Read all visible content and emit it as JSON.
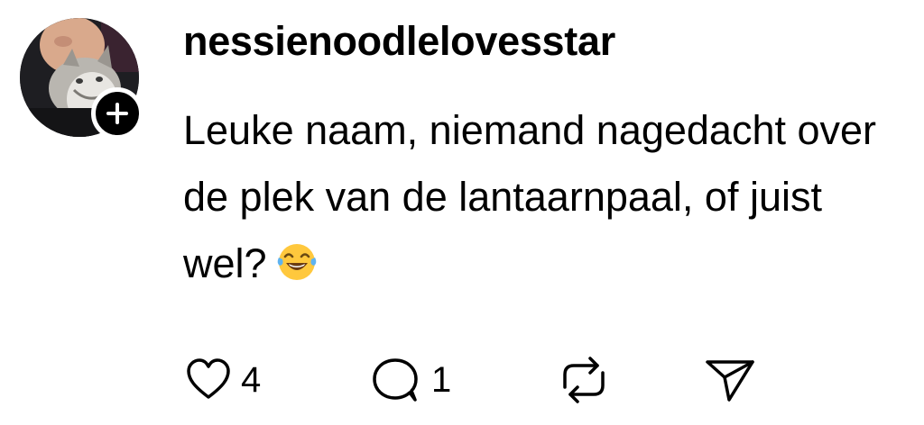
{
  "author": {
    "username": "nessienoodlelovesstar",
    "avatar_icon": "cat-avatar",
    "follow_icon": "plus-icon"
  },
  "comment": {
    "text": "Leuke naam, niemand nagedacht over de plek van de lantaarnpaal, of juist wel?",
    "emoji": "😂"
  },
  "actions": {
    "like": {
      "icon": "heart-icon",
      "count": "4"
    },
    "reply": {
      "icon": "comment-icon",
      "count": "1"
    },
    "repost": {
      "icon": "repost-icon"
    },
    "share": {
      "icon": "send-icon"
    }
  },
  "colors": {
    "text": "#000000",
    "background": "#ffffff",
    "icon_stroke": "#000000",
    "emoji_face": "#FFC83D"
  }
}
